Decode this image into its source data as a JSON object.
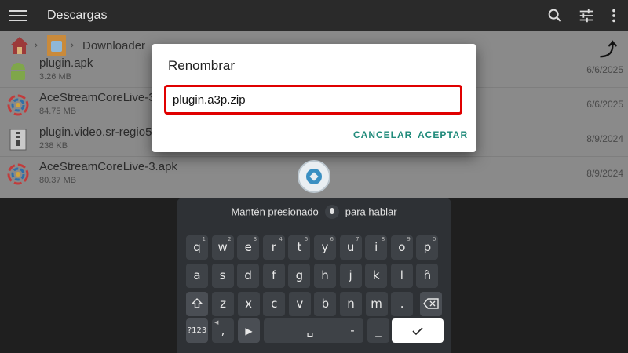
{
  "appbar": {
    "title": "Descargas"
  },
  "breadcrumb": {
    "folder": "Downloader"
  },
  "files": [
    {
      "name": "plugin.apk",
      "size": "3.26 MB",
      "date": "6/6/2025",
      "icon": "android-icon"
    },
    {
      "name": "AceStreamCoreLive-3",
      "size": "84.75 MB",
      "date": "6/6/2025",
      "icon": "acestream-icon"
    },
    {
      "name": "plugin.video.sr-regio5",
      "size": "238 KB",
      "date": "8/9/2024",
      "icon": "zip-icon"
    },
    {
      "name": "AceStreamCoreLive-3.apk",
      "size": "80.37 MB",
      "date": "8/9/2024",
      "icon": "acestream-icon"
    }
  ],
  "dialog": {
    "title": "Renombrar",
    "input_value": "plugin.a3p.zip",
    "cancel_label": "CANCELAR",
    "accept_label": "ACEPTAR"
  },
  "keyboard": {
    "hint_before": "Mantén presionado",
    "hint_after": "para hablar",
    "row1": [
      {
        "k": "q",
        "s": "1"
      },
      {
        "k": "w",
        "s": "2"
      },
      {
        "k": "e",
        "s": "3"
      },
      {
        "k": "r",
        "s": "4"
      },
      {
        "k": "t",
        "s": "5"
      },
      {
        "k": "y",
        "s": "6"
      },
      {
        "k": "u",
        "s": "7"
      },
      {
        "k": "i",
        "s": "8"
      },
      {
        "k": "o",
        "s": "9"
      },
      {
        "k": "p",
        "s": "0"
      }
    ],
    "row2": [
      "a",
      "s",
      "d",
      "f",
      "g",
      "h",
      "j",
      "k",
      "l",
      "ñ"
    ],
    "row3": [
      "z",
      "x",
      "c",
      "v",
      "b",
      "n",
      "m",
      "."
    ],
    "sym_label": "?123",
    "comma": ",",
    "dash": "-",
    "underscore": "_"
  },
  "colors": {
    "accent": "#1f8a7a",
    "field_border": "#e00000",
    "keyboard_bg": "#2e3135"
  }
}
